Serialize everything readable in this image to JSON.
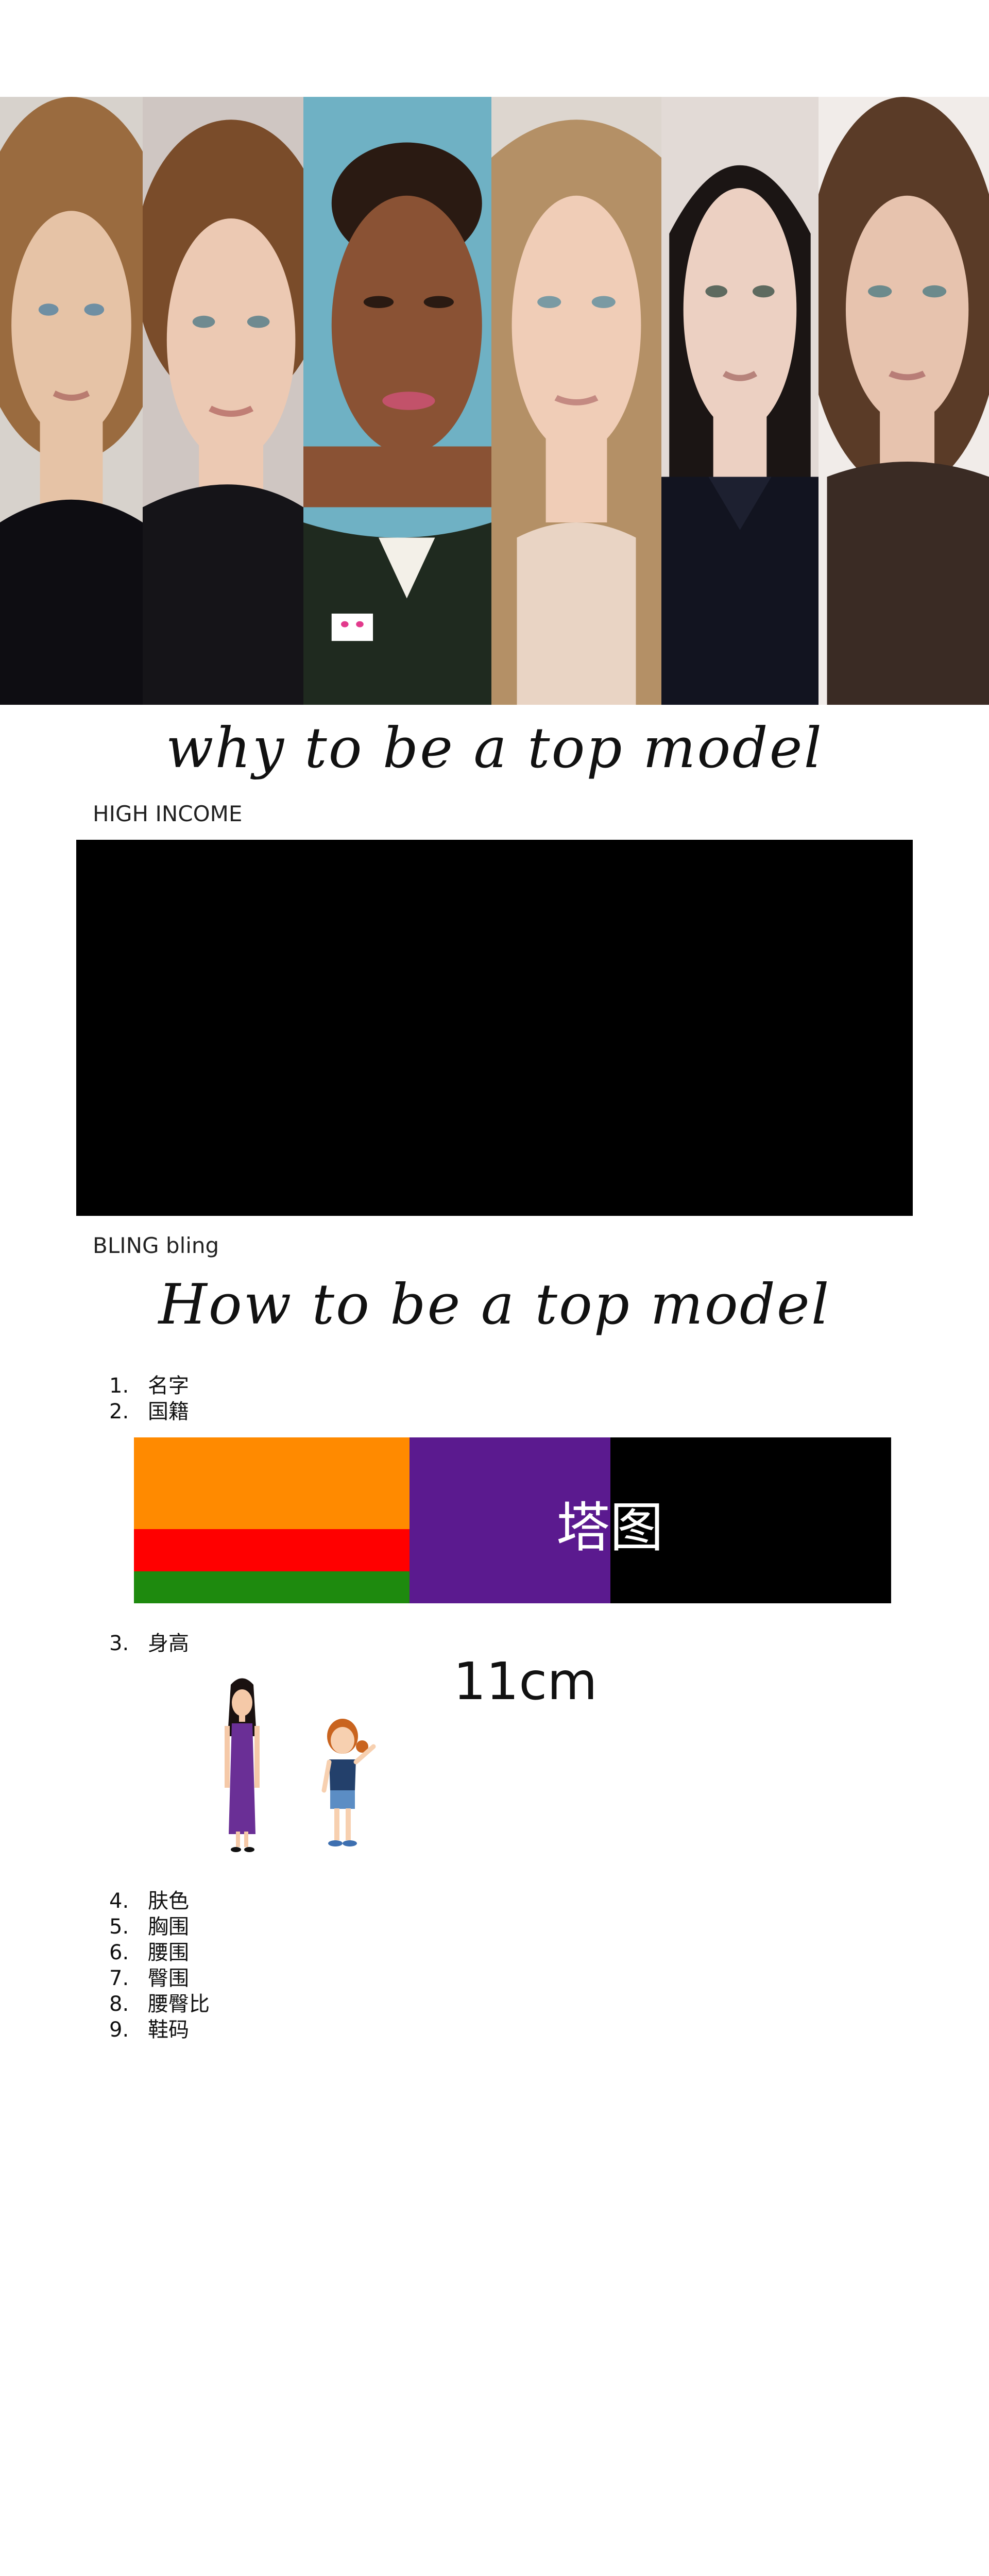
{
  "hero": {
    "portraits": [
      {
        "name": "portrait-1",
        "skin": "#e6c3a6",
        "hair": "#9a6b3f",
        "top": "#0e0d12",
        "bg": "#d7d2cc"
      },
      {
        "name": "portrait-2",
        "skin": "#ecc9b3",
        "hair": "#7a4c2a",
        "top": "#151418",
        "bg": "#cfc6c2"
      },
      {
        "name": "portrait-3",
        "skin": "#8a5234",
        "hair": "#2a1a12",
        "top": "#1f2a1f",
        "bg": "#6fb1c4"
      },
      {
        "name": "portrait-4",
        "skin": "#f0cdb7",
        "hair": "#b49066",
        "top": "#e9d4c4",
        "bg": "#ddd6cf"
      },
      {
        "name": "portrait-5",
        "skin": "#ecd0c2",
        "hair": "#1b1514",
        "top": "#121420",
        "bg": "#e2dad6"
      },
      {
        "name": "portrait-6",
        "skin": "#e7c3ae",
        "hair": "#5a3b27",
        "top": "#3a2b24",
        "bg": "#f1ece9"
      }
    ]
  },
  "titles": {
    "why": "why to be a top model",
    "how": "How to be a top model"
  },
  "captions": {
    "high_income": "HIGH INCOME",
    "bling": "BLING bling"
  },
  "list_a": [
    {
      "num": "1.",
      "text": "名字"
    },
    {
      "num": "2.",
      "text": "国籍"
    }
  ],
  "bar_block": {
    "label": "塔图",
    "colors": {
      "orange": "#ff8a00",
      "red": "#ff0000",
      "green": "#1e8a0e",
      "purple": "#5b1a8f",
      "background": "#000000"
    }
  },
  "list_b": [
    {
      "num": "3.",
      "text": "身高"
    }
  ],
  "height_section": {
    "value": "11cm",
    "icons": [
      "tall-woman-icon",
      "short-girl-icon"
    ]
  },
  "list_c": [
    {
      "num": "4.",
      "text": "肤色"
    },
    {
      "num": "5.",
      "text": "胸围"
    },
    {
      "num": "6.",
      "text": "腰围"
    },
    {
      "num": "7.",
      "text": "臀围"
    },
    {
      "num": "8.",
      "text": "腰臀比"
    },
    {
      "num": "9.",
      "text": "鞋码"
    }
  ]
}
